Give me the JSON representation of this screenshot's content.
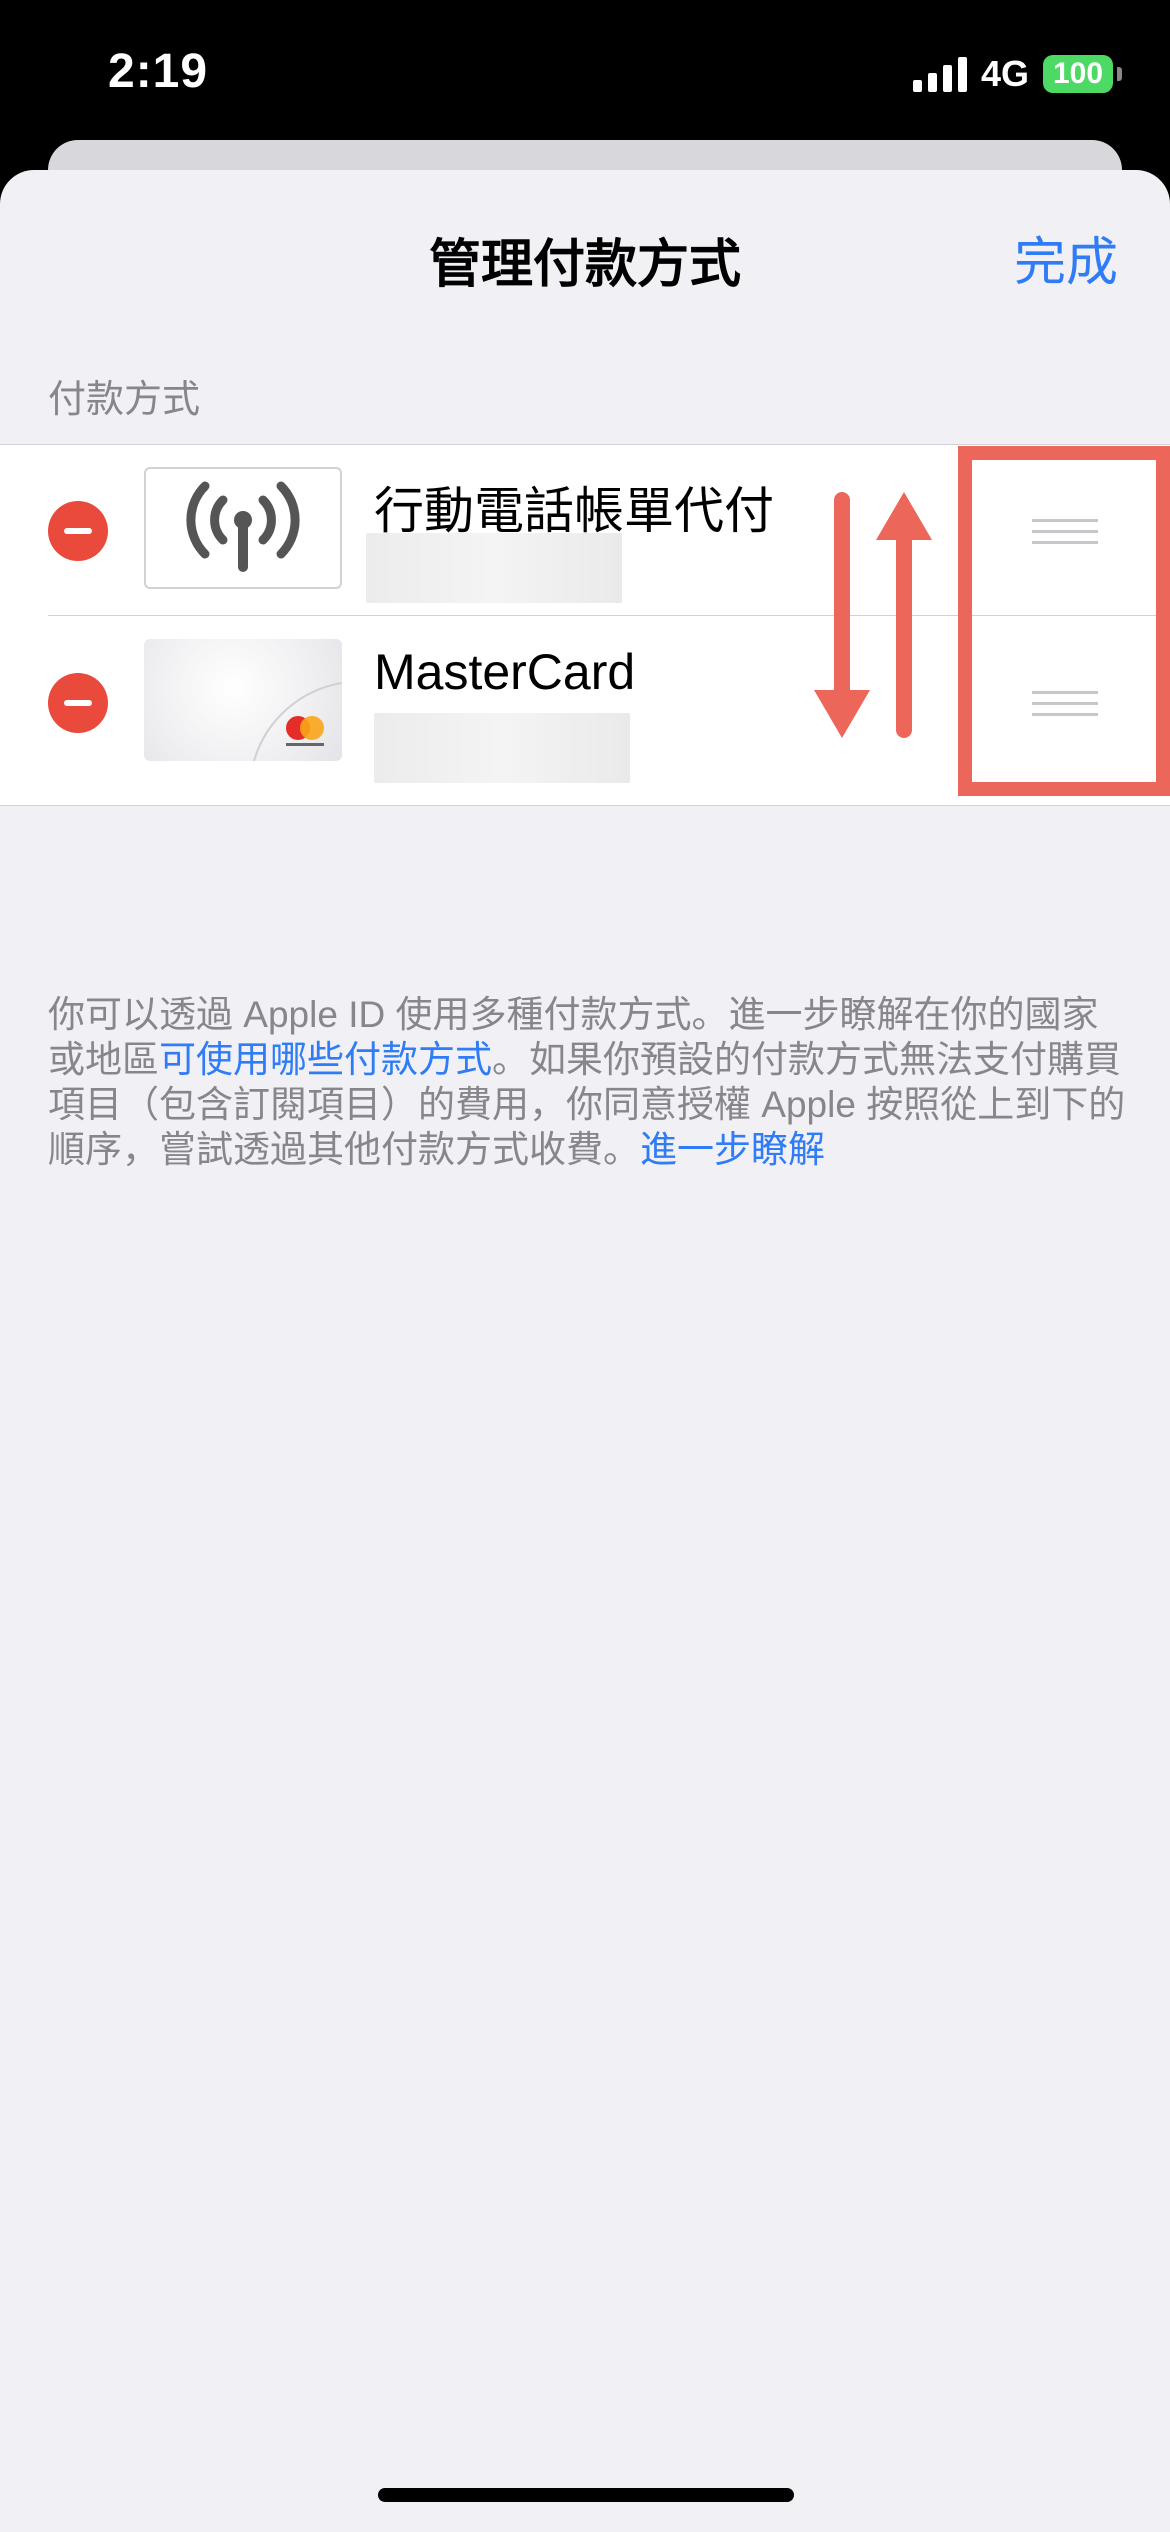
{
  "status_bar": {
    "time": "2:19",
    "network": "4G",
    "battery": "100"
  },
  "nav": {
    "title": "管理付款方式",
    "done_label": "完成"
  },
  "section_header": "付款方式",
  "payment_methods": [
    {
      "label": "行動電話帳單代付",
      "icon": "antenna-signal-icon"
    },
    {
      "label": "MasterCard",
      "icon": "mastercard-logo"
    }
  ],
  "footer": {
    "text_1": "你可以透過 Apple ID 使用多種付款方式。進一步瞭解在你的國家或地區",
    "link_1": "可使用哪些付款方式",
    "text_2": "。如果你預設的付款方式無法支付購買項目（包含訂閱項目）的費用，你同意授權 Apple 按照從上到下的順序，嘗試透過其他付款方式收費。",
    "link_2": "進一步瞭解"
  },
  "colors": {
    "accent": "#2f7cf6",
    "delete": "#e94a3b",
    "annotation": "#ec6659",
    "background": "#f0f0f5"
  }
}
